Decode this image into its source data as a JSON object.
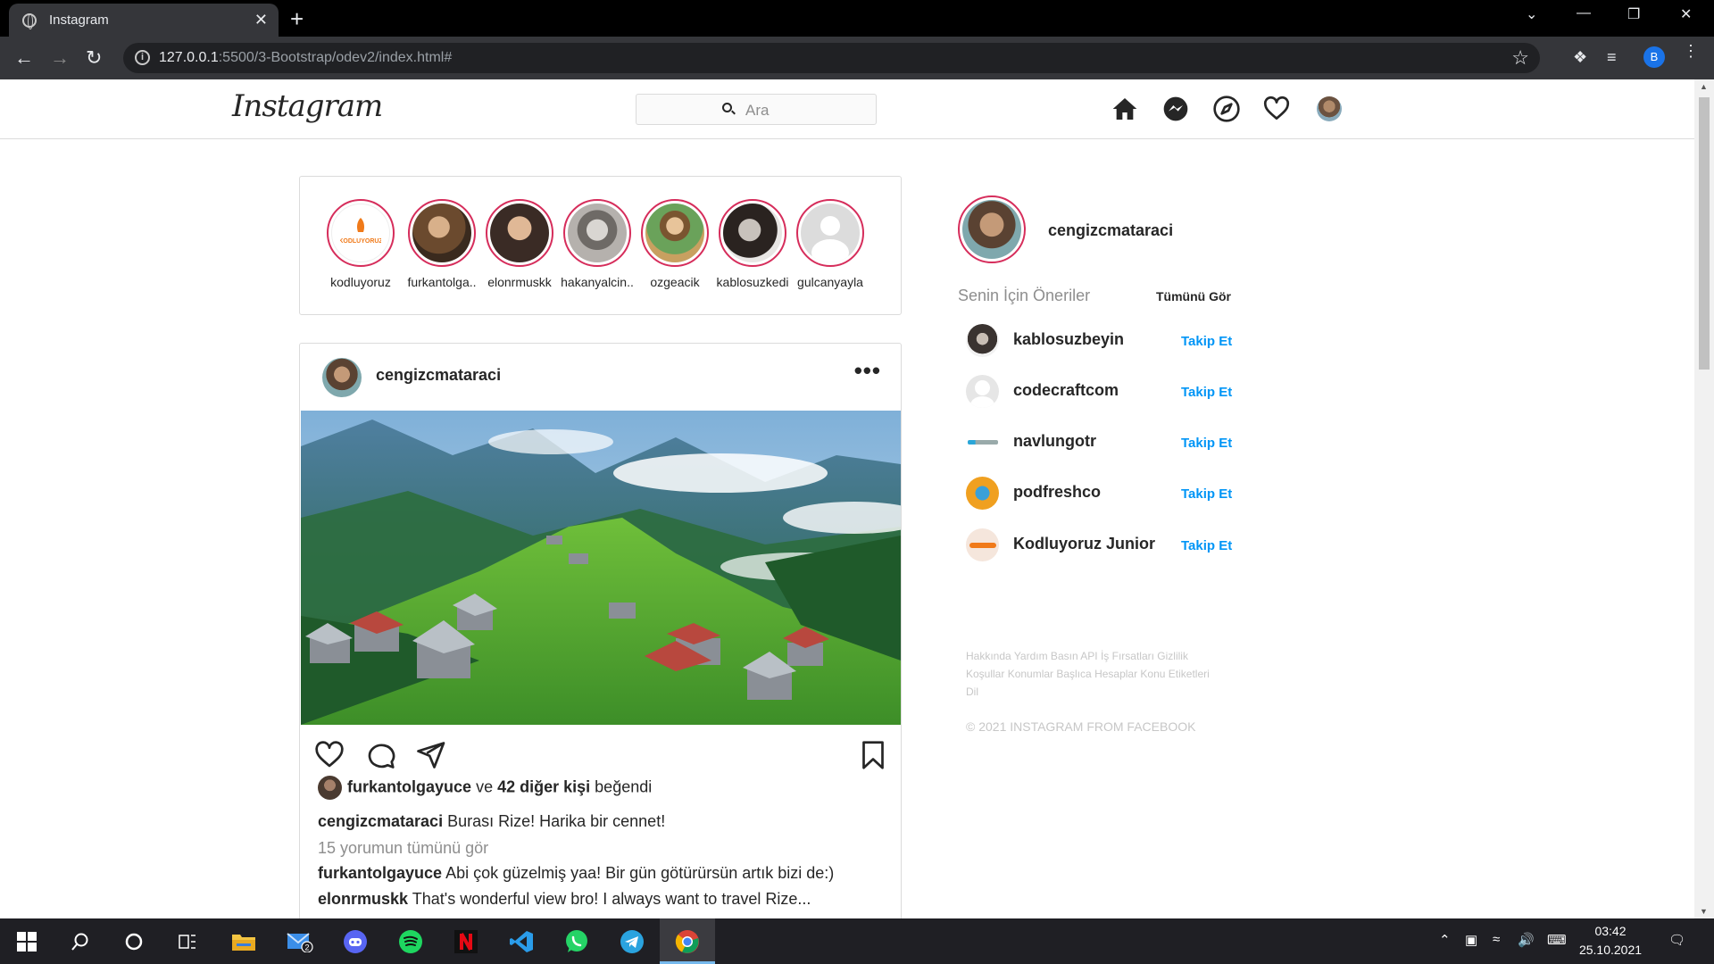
{
  "browser": {
    "tab_title": "Instagram",
    "close_label": "✕",
    "new_tab_label": "+",
    "url_host": "127.0.0.1",
    "url_rest": ":5500/3-Bootstrap/odev2/index.html#",
    "profile_initial": "B",
    "window_controls": {
      "minimize": "—",
      "restore": "❐",
      "close": "✕",
      "tab_search": "⌄"
    }
  },
  "header": {
    "logo": "Instagram",
    "search_placeholder": "Ara"
  },
  "stories": [
    {
      "name": "kodluyoruz",
      "color": "#fff"
    },
    {
      "name": "furkantolga..",
      "color": "#6b4a2e"
    },
    {
      "name": "elonrmuskk",
      "color": "#3a2b25"
    },
    {
      "name": "hakanyalcin..",
      "color": "#9a9590"
    },
    {
      "name": "ozgeacik",
      "color": "#c8a060"
    },
    {
      "name": "kablosuzkedi",
      "color": "#2a2320"
    },
    {
      "name": "gulcanyayla",
      "color": "#dcdcdc"
    }
  ],
  "post": {
    "username": "cengizcmataraci",
    "more": "•••",
    "liked_by": "furkantolgayuce",
    "liked_conj": "ve",
    "liked_others": "42 diğer kişi",
    "liked_suffix": "beğendi",
    "caption_user": "cengizcmataraci",
    "caption_text": "Burası Rize! Harika bir cennet!",
    "view_comments": "15 yorumun tümünü gör",
    "comments": [
      {
        "user": "furkantolgayuce",
        "text": "Abi çok güzelmiş yaa! Bir gün götürürsün artık bizi de:)"
      },
      {
        "user": "elonrmuskk",
        "text": "That's wonderful view bro! I always want to travel Rize..."
      }
    ]
  },
  "sidebar": {
    "me": "cengizcmataraci",
    "suggestions_title": "Senin İçin Öneriler",
    "see_all": "Tümünü Gör",
    "follow_label": "Takip Et",
    "suggestions": [
      {
        "name": "kablosuzbeyin",
        "color": "#3a3330"
      },
      {
        "name": "codecraftcom",
        "color": "#e6e6e6"
      },
      {
        "name": "navlungotr",
        "color": "#ffffff"
      },
      {
        "name": "podfreshco",
        "color": "#f0a020"
      },
      {
        "name": "Kodluyoruz Junior",
        "color": "#f5e6dc"
      }
    ],
    "footer_links": "Hakkında Yardım Basın API İş Fırsatları Gizlilik Koşullar Konumlar Başlıca Hesaplar Konu Etiketleri Dil",
    "copyright": "© 2021 INSTAGRAM FROM FACEBOOK"
  },
  "taskbar": {
    "time": "03:42",
    "date": "25.10.2021",
    "mail_badge": "2"
  }
}
